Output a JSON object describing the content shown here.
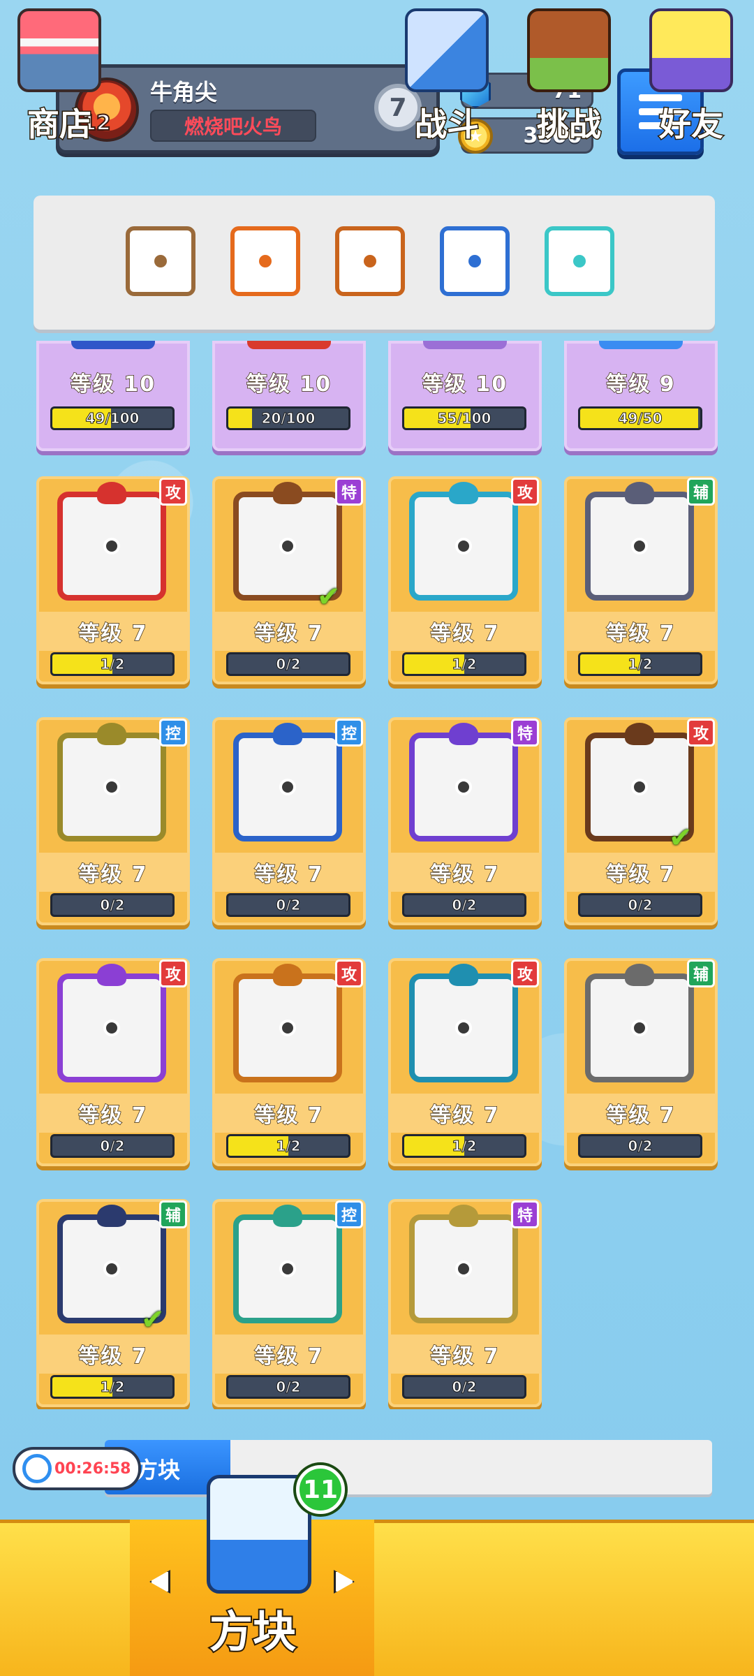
{
  "player": {
    "name": "牛角尖",
    "level": "12",
    "title": "燃烧吧火鸟",
    "rank": "7"
  },
  "currency": {
    "gems": "71",
    "coins": "3506"
  },
  "equipped": [
    {
      "name": "mystery-block-icon",
      "color": "#9a6a3a"
    },
    {
      "name": "fire-blade-icon",
      "color": "#e56a1c"
    },
    {
      "name": "rainbow-infinity-icon",
      "color": "#c9641c"
    },
    {
      "name": "crescent-moon-icon",
      "color": "#2e6fd3"
    },
    {
      "name": "ice-burst-icon",
      "color": "#3bc7c7"
    }
  ],
  "purple_cards": [
    {
      "level": "等级 10",
      "progress": "49/100",
      "fill": 0.49,
      "stub": "#2f56c9"
    },
    {
      "level": "等级 10",
      "progress": "20/100",
      "fill": 0.2,
      "stub": "#d93a2e"
    },
    {
      "level": "等级 10",
      "progress": "55/100",
      "fill": 0.55,
      "stub": "#9b6fd6"
    },
    {
      "level": "等级 9",
      "progress": "49/50",
      "fill": 0.98,
      "stub": "#3a8cf2"
    }
  ],
  "cards": [
    {
      "level": "等级 7",
      "progress": "1/2",
      "fill": 0.5,
      "tag": "攻",
      "tag_color": "#e23b3b",
      "frame": "#d6322e",
      "checked": false
    },
    {
      "level": "等级 7",
      "progress": "0/2",
      "fill": 0,
      "tag": "特",
      "tag_color": "#9b3fd4",
      "frame": "#8a4b20",
      "checked": true
    },
    {
      "level": "等级 7",
      "progress": "1/2",
      "fill": 0.5,
      "tag": "攻",
      "tag_color": "#e23b3b",
      "frame": "#2aa7c9",
      "checked": false
    },
    {
      "level": "等级 7",
      "progress": "1/2",
      "fill": 0.5,
      "tag": "辅",
      "tag_color": "#21a55a",
      "frame": "#5a5e78",
      "checked": false
    },
    {
      "level": "等级 7",
      "progress": "0/2",
      "fill": 0,
      "tag": "控",
      "tag_color": "#2f8fe8",
      "frame": "#9a8a2a",
      "checked": false
    },
    {
      "level": "等级 7",
      "progress": "0/2",
      "fill": 0,
      "tag": "控",
      "tag_color": "#2f8fe8",
      "frame": "#2b63c9",
      "checked": false
    },
    {
      "level": "等级 7",
      "progress": "0/2",
      "fill": 0,
      "tag": "特",
      "tag_color": "#9b3fd4",
      "frame": "#6f3fd0",
      "checked": false
    },
    {
      "level": "等级 7",
      "progress": "0/2",
      "fill": 0,
      "tag": "攻",
      "tag_color": "#e23b3b",
      "frame": "#6a3a1c",
      "checked": true
    },
    {
      "level": "等级 7",
      "progress": "0/2",
      "fill": 0,
      "tag": "攻",
      "tag_color": "#e23b3b",
      "frame": "#8b3fd4",
      "checked": false
    },
    {
      "level": "等级 7",
      "progress": "1/2",
      "fill": 0.5,
      "tag": "攻",
      "tag_color": "#e23b3b",
      "frame": "#c9721c",
      "checked": false
    },
    {
      "level": "等级 7",
      "progress": "1/2",
      "fill": 0.5,
      "tag": "攻",
      "tag_color": "#e23b3b",
      "frame": "#1f8fb0",
      "checked": false
    },
    {
      "level": "等级 7",
      "progress": "0/2",
      "fill": 0,
      "tag": "辅",
      "tag_color": "#21a55a",
      "frame": "#6b6b6b",
      "checked": false
    },
    {
      "level": "等级 7",
      "progress": "1/2",
      "fill": 0.5,
      "tag": "辅",
      "tag_color": "#21a55a",
      "frame": "#2b3a6e",
      "checked": true
    },
    {
      "level": "等级 7",
      "progress": "0/2",
      "fill": 0,
      "tag": "控",
      "tag_color": "#2f8fe8",
      "frame": "#2ba18a",
      "checked": false
    },
    {
      "level": "等级 7",
      "progress": "0/2",
      "fill": 0,
      "tag": "特",
      "tag_color": "#9b3fd4",
      "frame": "#b59a3a",
      "checked": false
    }
  ],
  "event": {
    "timer": "00:26:58",
    "label": "方块"
  },
  "nav": {
    "shop": "商店",
    "blocks": "方块",
    "battle": "战斗",
    "challenge": "挑战",
    "friends": "好友",
    "blocks_badge": "11"
  }
}
